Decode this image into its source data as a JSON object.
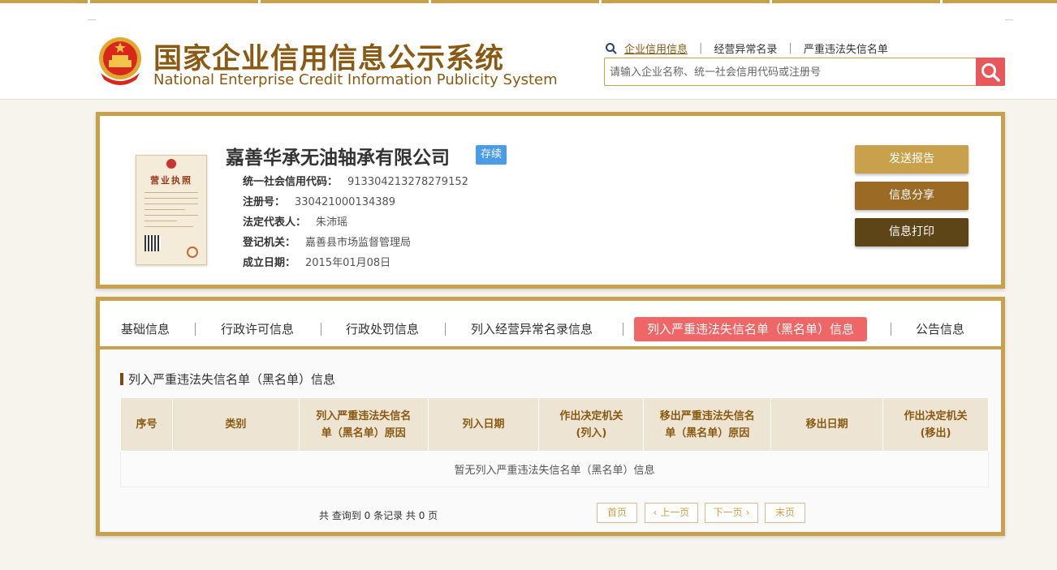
{
  "header": {
    "site_title_cn": "国家企业信用信息公示系统",
    "site_title_en": "National Enterprise Credit Information Publicity System",
    "top_links": [
      "企业信用信息",
      "经营异常名录",
      "严重违法失信名单"
    ],
    "separator": "|",
    "search_placeholder": "请输入企业名称、统一社会信用代码或注册号"
  },
  "company": {
    "name": "嘉善华承无油轴承有限公司",
    "status": "存续",
    "license_title": "营业执照",
    "fields": [
      {
        "label": "统一社会信用代码：",
        "value": "913304213278279152"
      },
      {
        "label": "注册号：",
        "value": "330421000134389"
      },
      {
        "label": "法定代表人：",
        "value": "朱沛瑶"
      },
      {
        "label": "登记机关：",
        "value": "嘉善县市场监督管理局"
      },
      {
        "label": "成立日期：",
        "value": "2015年01月08日"
      }
    ],
    "actions": [
      "发送报告",
      "信息分享",
      "信息打印"
    ]
  },
  "tabs": [
    "基础信息",
    "行政许可信息",
    "行政处罚信息",
    "列入经营异常名录信息",
    "列入严重违法失信名单（黑名单）信息",
    "公告信息"
  ],
  "active_tab_index": 4,
  "section": {
    "title": "列入严重违法失信名单（黑名单）信息",
    "columns": [
      [
        "序号"
      ],
      [
        "类别"
      ],
      [
        "列入严重违法失信名",
        "单（黑名单）原因"
      ],
      [
        "列入日期"
      ],
      [
        "作出决定机关",
        "(列入)"
      ],
      [
        "移出严重违法失信名",
        "单（黑名单）原因"
      ],
      [
        "移出日期"
      ],
      [
        "作出决定机关",
        "(移出)"
      ]
    ],
    "empty_message": "暂无列入严重违法失信名单（黑名单）信息"
  },
  "pagination": {
    "summary": "共 查询到 0 条记录 共 0 页",
    "first": "首页",
    "prev": "上一页",
    "next": "下一页",
    "last": "末页"
  },
  "colors": {
    "gold": "#c9a04b",
    "brown_text": "#8a5a12",
    "active_tab": "#ef6667",
    "status_badge": "#4c9be8",
    "btn_send": "#c9a04b",
    "btn_share": "#9b6a25",
    "btn_print": "#5e4518"
  }
}
